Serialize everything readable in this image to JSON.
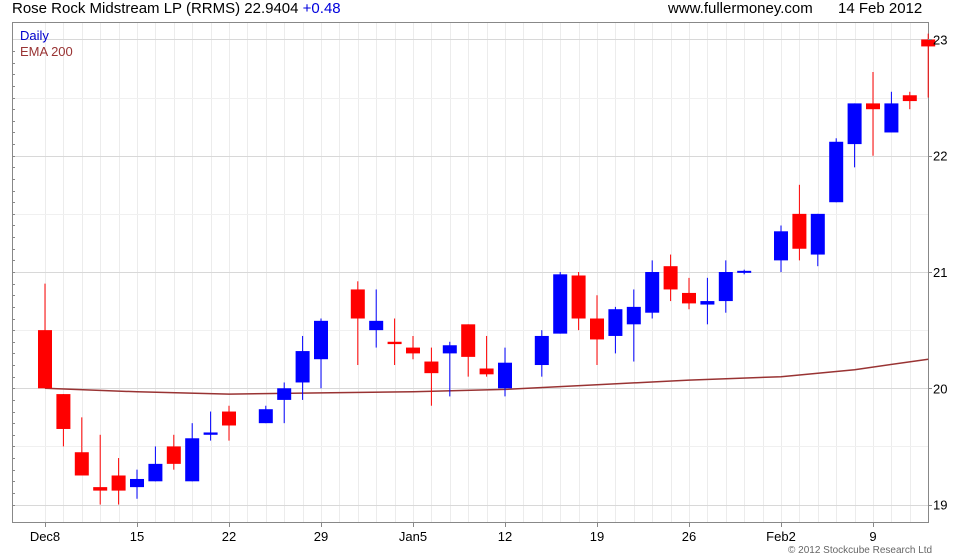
{
  "header": {
    "title": "Rose Rock Midstream LP (RRMS) 22.9404",
    "change": "+0.48",
    "site": "www.fullermoney.com",
    "date": "14 Feb 2012"
  },
  "footer": {
    "copyright": "© 2012 Stockcube Research Ltd"
  },
  "colors": {
    "up": "#0000ff",
    "down": "#ff0000",
    "ema": "#993333",
    "grid": "#d8d8d8",
    "daily_label": "#0000cc"
  },
  "chart_data": {
    "type": "candlestick",
    "legend": [
      "Daily",
      "EMA 200"
    ],
    "ylim": [
      18.85,
      23.15
    ],
    "y_ticks": [
      19,
      20,
      21,
      22,
      23
    ],
    "x_tick_labels": [
      "Dec8",
      "15",
      "22",
      "29",
      "Jan5",
      "12",
      "19",
      "26",
      "Feb2",
      "9"
    ],
    "x_tick_days": [
      0,
      5,
      10,
      15,
      20,
      25,
      30,
      35,
      40,
      45
    ],
    "candles": [
      {
        "d": 0,
        "o": 20.5,
        "h": 20.9,
        "l": 20.0,
        "c": 20.0
      },
      {
        "d": 1,
        "o": 19.95,
        "h": 19.95,
        "l": 19.5,
        "c": 19.65
      },
      {
        "d": 2,
        "o": 19.45,
        "h": 19.75,
        "l": 19.25,
        "c": 19.25
      },
      {
        "d": 3,
        "o": 19.15,
        "h": 19.6,
        "l": 19.0,
        "c": 19.12
      },
      {
        "d": 4,
        "o": 19.25,
        "h": 19.4,
        "l": 19.0,
        "c": 19.12
      },
      {
        "d": 5,
        "o": 19.15,
        "h": 19.3,
        "l": 19.05,
        "c": 19.22
      },
      {
        "d": 6,
        "o": 19.2,
        "h": 19.5,
        "l": 19.2,
        "c": 19.35
      },
      {
        "d": 7,
        "o": 19.5,
        "h": 19.6,
        "l": 19.3,
        "c": 19.35
      },
      {
        "d": 8,
        "o": 19.2,
        "h": 19.7,
        "l": 19.2,
        "c": 19.57
      },
      {
        "d": 9,
        "o": 19.6,
        "h": 19.8,
        "l": 19.55,
        "c": 19.62
      },
      {
        "d": 10,
        "o": 19.8,
        "h": 19.85,
        "l": 19.55,
        "c": 19.68
      },
      {
        "d": 12,
        "o": 19.7,
        "h": 19.85,
        "l": 19.7,
        "c": 19.82
      },
      {
        "d": 13,
        "o": 19.9,
        "h": 20.05,
        "l": 19.7,
        "c": 20.0
      },
      {
        "d": 14,
        "o": 20.05,
        "h": 20.45,
        "l": 19.9,
        "c": 20.32
      },
      {
        "d": 15,
        "o": 20.25,
        "h": 20.6,
        "l": 20.0,
        "c": 20.58
      },
      {
        "d": 17,
        "o": 20.85,
        "h": 20.92,
        "l": 20.2,
        "c": 20.6
      },
      {
        "d": 18,
        "o": 20.5,
        "h": 20.85,
        "l": 20.35,
        "c": 20.58
      },
      {
        "d": 19,
        "o": 20.4,
        "h": 20.6,
        "l": 20.2,
        "c": 20.38
      },
      {
        "d": 20,
        "o": 20.35,
        "h": 20.45,
        "l": 20.25,
        "c": 20.3
      },
      {
        "d": 21,
        "o": 20.23,
        "h": 20.35,
        "l": 19.85,
        "c": 20.13
      },
      {
        "d": 22,
        "o": 20.3,
        "h": 20.4,
        "l": 19.93,
        "c": 20.37
      },
      {
        "d": 23,
        "o": 20.55,
        "h": 20.55,
        "l": 20.1,
        "c": 20.27
      },
      {
        "d": 24,
        "o": 20.17,
        "h": 20.45,
        "l": 20.1,
        "c": 20.12
      },
      {
        "d": 25,
        "o": 20.0,
        "h": 20.35,
        "l": 19.93,
        "c": 20.22
      },
      {
        "d": 27,
        "o": 20.2,
        "h": 20.5,
        "l": 20.1,
        "c": 20.45
      },
      {
        "d": 28,
        "o": 20.47,
        "h": 21.0,
        "l": 20.47,
        "c": 20.98
      },
      {
        "d": 29,
        "o": 20.97,
        "h": 21.0,
        "l": 20.5,
        "c": 20.6
      },
      {
        "d": 30,
        "o": 20.6,
        "h": 20.8,
        "l": 20.2,
        "c": 20.42
      },
      {
        "d": 31,
        "o": 20.45,
        "h": 20.7,
        "l": 20.3,
        "c": 20.68
      },
      {
        "d": 32,
        "o": 20.55,
        "h": 20.85,
        "l": 20.23,
        "c": 20.7
      },
      {
        "d": 33,
        "o": 20.65,
        "h": 21.1,
        "l": 20.6,
        "c": 21.0
      },
      {
        "d": 34,
        "o": 21.05,
        "h": 21.15,
        "l": 20.75,
        "c": 20.85
      },
      {
        "d": 35,
        "o": 20.82,
        "h": 20.95,
        "l": 20.68,
        "c": 20.73
      },
      {
        "d": 36,
        "o": 20.72,
        "h": 20.95,
        "l": 20.55,
        "c": 20.75
      },
      {
        "d": 37,
        "o": 20.75,
        "h": 21.1,
        "l": 20.65,
        "c": 21.0
      },
      {
        "d": 38,
        "o": 21.0,
        "h": 21.02,
        "l": 20.98,
        "c": 21.01
      },
      {
        "d": 40,
        "o": 21.1,
        "h": 21.4,
        "l": 21.0,
        "c": 21.35
      },
      {
        "d": 41,
        "o": 21.5,
        "h": 21.75,
        "l": 21.1,
        "c": 21.2
      },
      {
        "d": 42,
        "o": 21.15,
        "h": 21.5,
        "l": 21.05,
        "c": 21.5
      },
      {
        "d": 43,
        "o": 21.6,
        "h": 22.15,
        "l": 21.6,
        "c": 22.12
      },
      {
        "d": 44,
        "o": 22.1,
        "h": 22.45,
        "l": 21.9,
        "c": 22.45
      },
      {
        "d": 45,
        "o": 22.45,
        "h": 22.72,
        "l": 22.0,
        "c": 22.4
      },
      {
        "d": 46,
        "o": 22.2,
        "h": 22.55,
        "l": 22.2,
        "c": 22.45
      },
      {
        "d": 47,
        "o": 22.52,
        "h": 22.55,
        "l": 22.4,
        "c": 22.47
      },
      {
        "d": 48,
        "o": 23.0,
        "h": 23.05,
        "l": 22.5,
        "c": 22.94
      }
    ],
    "ema200": [
      {
        "d": 0,
        "v": 20.0
      },
      {
        "d": 5,
        "v": 19.97
      },
      {
        "d": 10,
        "v": 19.95
      },
      {
        "d": 15,
        "v": 19.96
      },
      {
        "d": 20,
        "v": 19.97
      },
      {
        "d": 25,
        "v": 19.99
      },
      {
        "d": 30,
        "v": 20.03
      },
      {
        "d": 35,
        "v": 20.07
      },
      {
        "d": 40,
        "v": 20.1
      },
      {
        "d": 44,
        "v": 20.16
      },
      {
        "d": 48,
        "v": 20.25
      }
    ]
  }
}
